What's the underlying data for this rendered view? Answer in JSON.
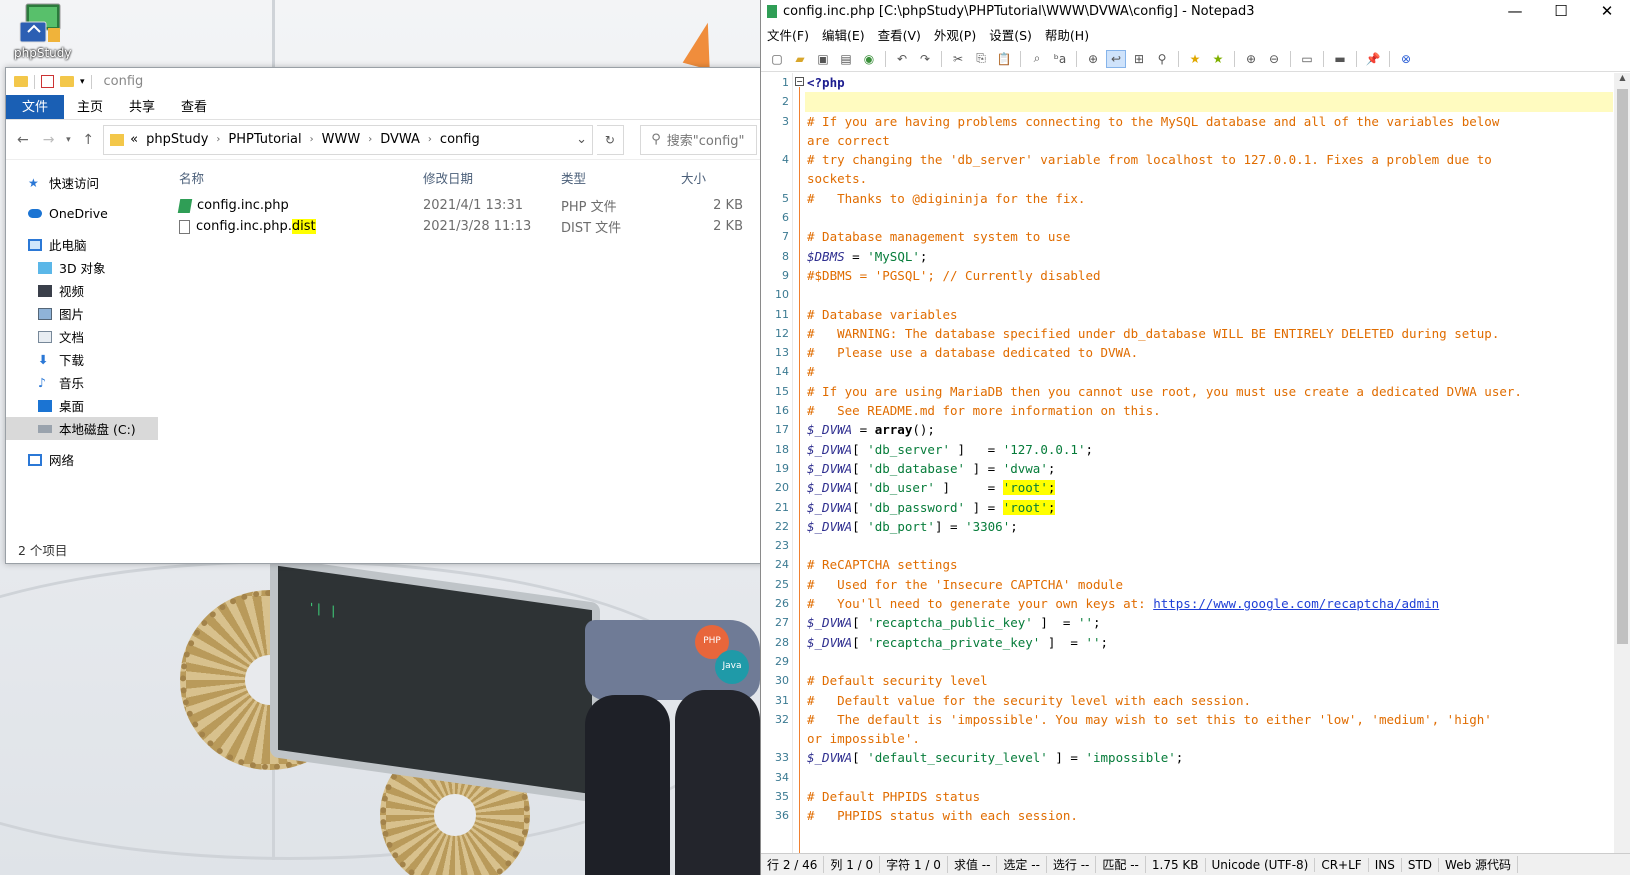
{
  "desktop": {
    "icon_label": "phpStudy",
    "monitor_text": "'|\n   |"
  },
  "explorer": {
    "qat_title": "config",
    "ribbon_tabs": [
      "文件",
      "主页",
      "共享",
      "查看"
    ],
    "breadcrumb": [
      "«",
      "phpStudy",
      "PHPTutorial",
      "WWW",
      "DVWA",
      "config"
    ],
    "search_placeholder": "搜索\"config\"",
    "nav": [
      {
        "label": "快速访问",
        "icon": "star-icon"
      },
      {
        "label": "OneDrive",
        "icon": "cloud-icon"
      },
      {
        "label": "此电脑",
        "icon": "computer-icon"
      },
      {
        "label": "3D 对象",
        "icon": "cube-icon"
      },
      {
        "label": "视频",
        "icon": "video-icon"
      },
      {
        "label": "图片",
        "icon": "picture-icon"
      },
      {
        "label": "文档",
        "icon": "document-icon"
      },
      {
        "label": "下载",
        "icon": "download-icon"
      },
      {
        "label": "音乐",
        "icon": "music-icon"
      },
      {
        "label": "桌面",
        "icon": "desktop-icon"
      },
      {
        "label": "本地磁盘 (C:)",
        "icon": "drive-icon"
      },
      {
        "label": "网络",
        "icon": "network-icon"
      }
    ],
    "columns": {
      "name": "名称",
      "date": "修改日期",
      "type": "类型",
      "size": "大小"
    },
    "files": [
      {
        "name": "config.inc.php",
        "name_ext_highlight": "",
        "date": "2021/4/1 13:31",
        "type": "PHP 文件",
        "size": "2 KB"
      },
      {
        "name": "config.inc.php.",
        "name_ext_highlight": "dist",
        "date": "2021/3/28 11:13",
        "type": "DIST 文件",
        "size": "2 KB"
      }
    ],
    "status": "2 个项目"
  },
  "notepad": {
    "title": "config.inc.php [C:\\phpStudy\\PHPTutorial\\WWW\\DVWA\\config] - Notepad3",
    "menu": [
      "文件(F)",
      "编辑(E)",
      "查看(V)",
      "外观(P)",
      "设置(S)",
      "帮助(H)"
    ],
    "status": [
      "行 2 / 46",
      "列 1 / 0",
      "字符 1 / 0",
      "求值 --",
      "选定 --",
      "选行 --",
      "匹配 --",
      "1.75 KB",
      "Unicode (UTF-8)",
      "CR+LF",
      "INS",
      "STD",
      "Web 源代码"
    ],
    "lines": [
      "<?php",
      "",
      "# If you are having problems connecting to the MySQL database and all of the variables below",
      "are correct",
      "# try changing the 'db_server' variable from localhost to 127.0.0.1. Fixes a problem due to",
      "sockets.",
      "#   Thanks to @digininja for the fix.",
      "",
      "# Database management system to use",
      "$DBMS = 'MySQL';",
      "#$DBMS = 'PGSQL'; // Currently disabled",
      "",
      "# Database variables",
      "#   WARNING: The database specified under db_database WILL BE ENTIRELY DELETED during setup.",
      "#   Please use a database dedicated to DVWA.",
      "#",
      "# If you are using MariaDB then you cannot use root, you must use create a dedicated DVWA user.",
      "#   See README.md for more information on this.",
      "$_DVWA = array();",
      "$_DVWA[ 'db_server' ]   = '127.0.0.1';",
      "$_DVWA[ 'db_database' ] = 'dvwa';",
      "$_DVWA[ 'db_user' ]     = 'root';",
      "$_DVWA[ 'db_password' ] = 'root';",
      "$_DVWA[ 'db_port'] = '3306';",
      "",
      "# ReCAPTCHA settings",
      "#   Used for the 'Insecure CAPTCHA' module",
      "#   You'll need to generate your own keys at: https://www.google.com/recaptcha/admin",
      "$_DVWA[ 'recaptcha_public_key' ]  = '';",
      "$_DVWA[ 'recaptcha_private_key' ]  = '';",
      "",
      "# Default security level",
      "#   Default value for the security level with each session.",
      "#   The default is 'impossible'. You may wish to set this to either 'low', 'medium', 'high'",
      "or impossible'.",
      "$_DVWA[ 'default_security_level' ] = 'impossible';",
      "",
      "# Default PHPIDS status",
      "#   PHPIDS status with each session."
    ],
    "line_numbers": [
      "1",
      "2",
      "3",
      "",
      "4",
      "",
      "5",
      "6",
      "7",
      "8",
      "9",
      "10",
      "11",
      "12",
      "13",
      "14",
      "15",
      "16",
      "17",
      "18",
      "19",
      "20",
      "21",
      "22",
      "23",
      "24",
      "25",
      "26",
      "27",
      "28",
      "29",
      "30",
      "31",
      "32",
      "",
      "33",
      "34",
      "35",
      "36"
    ]
  }
}
